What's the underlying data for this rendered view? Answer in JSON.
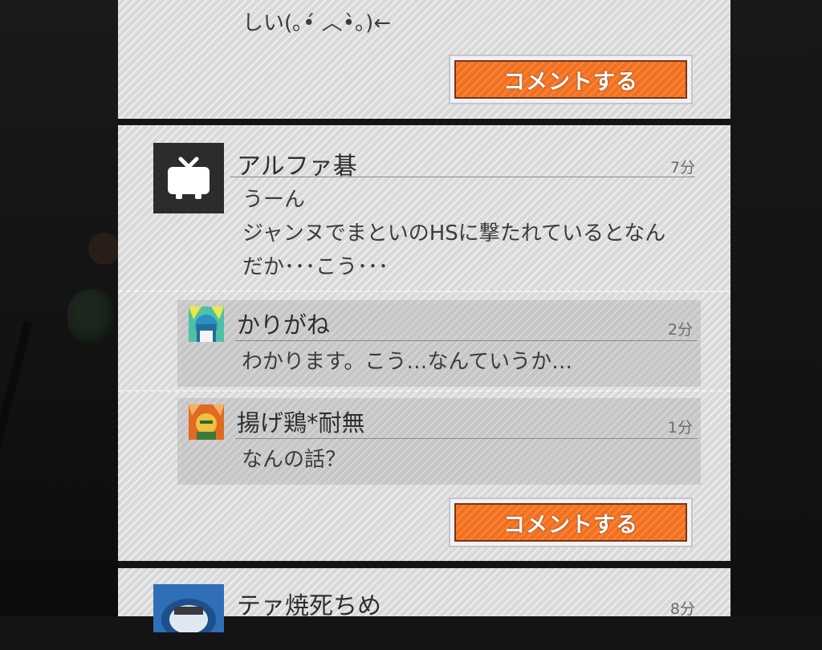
{
  "thread_prev": {
    "tail_text": "しい(｡•́ ︿•̀｡)←",
    "comment_button_label": "コメントする"
  },
  "post": {
    "author": "アルファ碁",
    "time": "7分",
    "avatar_icon": "tv-icon",
    "lines": [
      "うーん",
      "ジャンヌでまといのHSに撃たれているとなん",
      "だか･･･こう･･･"
    ],
    "replies": [
      {
        "author": "かりがね",
        "time": "2分",
        "avatar_icon": "character-avatar-icon",
        "text": "わかります。こう…なんていうか…"
      },
      {
        "author": "揚げ鶏*耐無",
        "time": "1分",
        "avatar_icon": "character-avatar-icon",
        "text": "なんの話？"
      }
    ],
    "comment_button_label": "コメントする"
  },
  "next_post": {
    "author": "テァ焼死ちめ",
    "time": "8分",
    "avatar_icon": "character-avatar-icon"
  },
  "colors": {
    "accent": "#f2701e",
    "card": "#d9d9d9"
  }
}
